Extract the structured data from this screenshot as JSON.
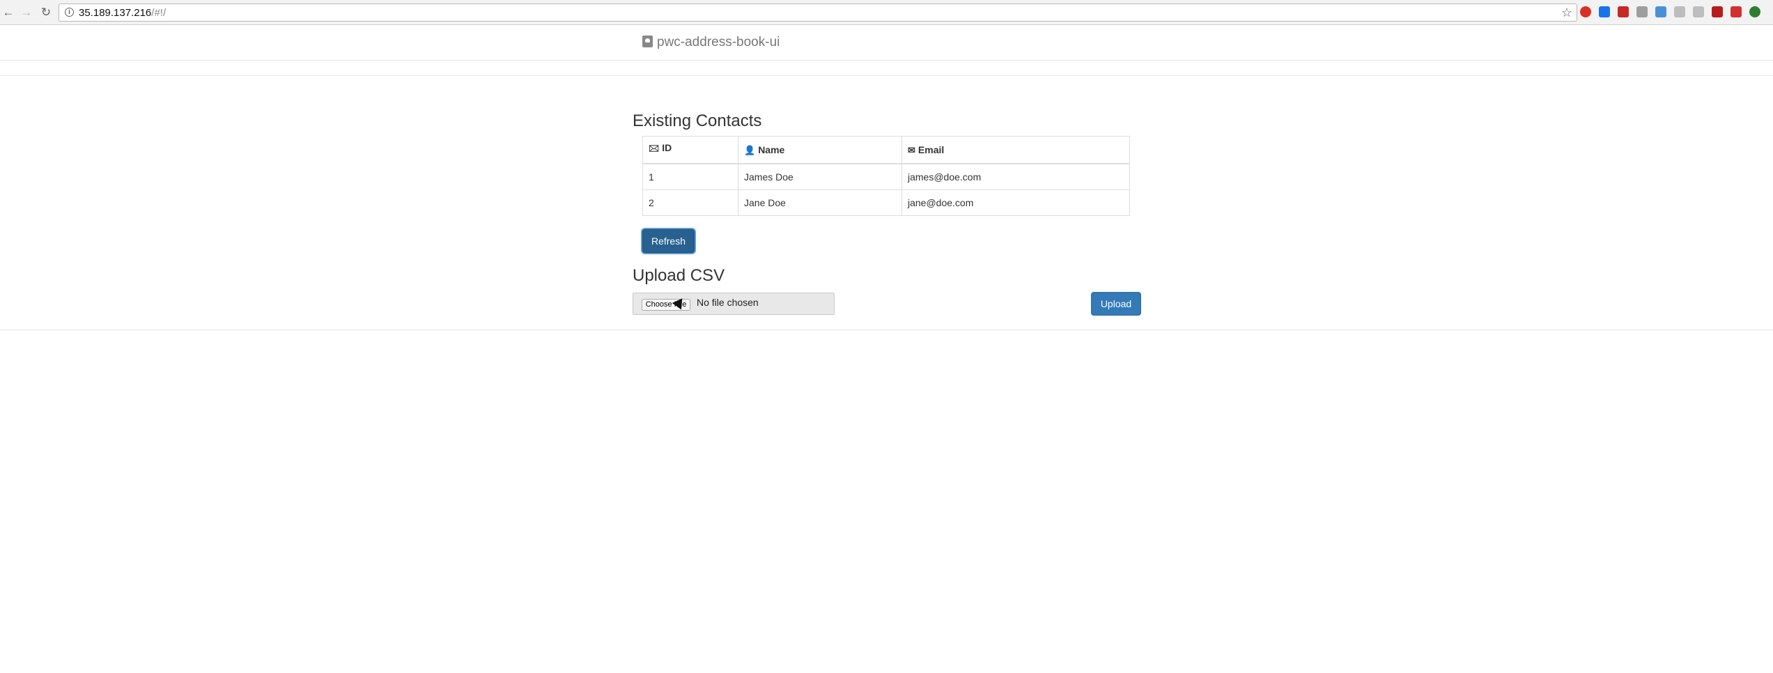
{
  "browser": {
    "url_host": "35.189.137.216",
    "url_path": "/#!/",
    "back_icon": "arrow-left-icon",
    "forward_icon": "arrow-right-icon",
    "reload_icon": "reload-icon",
    "extension_colors": [
      "#d93025",
      "#1a73e8",
      "#c62828",
      "#9e9e9e",
      "#4a90d9",
      "#bdbdbd",
      "#bdbdbd",
      "#b71c1c",
      "#d32f2f",
      "#2e7d32"
    ]
  },
  "header": {
    "brand": "pwc-address-book-ui",
    "brand_icon": "address-book-icon"
  },
  "contacts": {
    "title": "Existing Contacts",
    "columns": [
      {
        "label": "ID",
        "icon": "id-card-icon"
      },
      {
        "label": "Name",
        "icon": "user-icon"
      },
      {
        "label": "Email",
        "icon": "envelope-icon"
      }
    ],
    "rows": [
      {
        "id": "1",
        "name": "James Doe",
        "email": "james@doe.com"
      },
      {
        "id": "2",
        "name": "Jane Doe",
        "email": "jane@doe.com"
      }
    ],
    "refresh_label": "Refresh"
  },
  "upload": {
    "title": "Upload CSV",
    "choose_label": "Choose File",
    "no_file_label": "No file chosen",
    "upload_label": "Upload"
  }
}
